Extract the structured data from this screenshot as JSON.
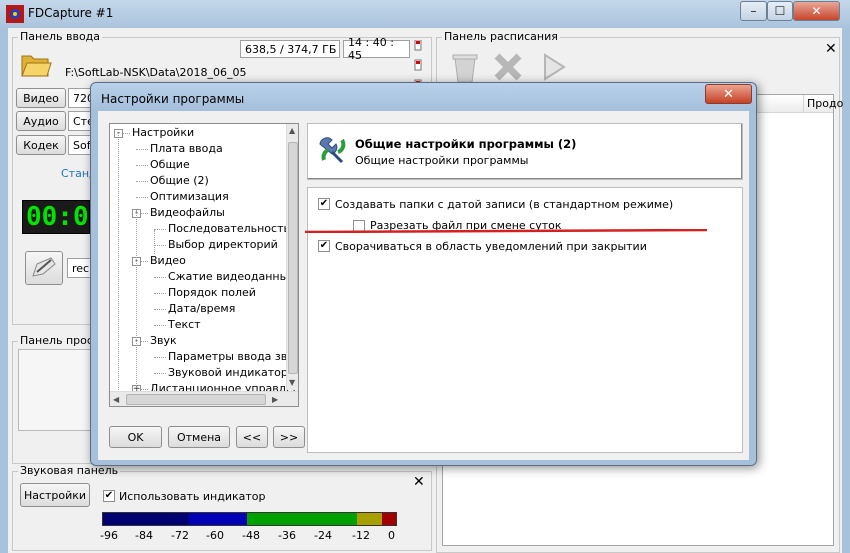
{
  "app": {
    "title": "FDCapture #1",
    "window_controls": {
      "minimize": "–",
      "maximize": "☐",
      "close": "✕"
    }
  },
  "input_panel": {
    "label": "Панель ввода",
    "disk_space": "638,5 / 374,7 ГБ",
    "time": "14 : 40 : 45",
    "path": "F:\\SoftLab-NSK\\Data\\2018_06_05",
    "video_label": "Видео",
    "video_value": "720",
    "audio_label": "Аудио",
    "audio_value": "Сте",
    "codec_label": "Кодек",
    "codec_value": "Soft",
    "standard_link": "Станд",
    "timer_display": "00:0",
    "filename_value": "rec#"
  },
  "preview_panel": {
    "label": "Панель просмо"
  },
  "sound_panel": {
    "label": "Звуковая панель",
    "settings_button": "Настройки",
    "use_indicator_label": "Использовать индикатор",
    "use_indicator_checked": true,
    "meter_ticks": [
      "-96",
      "-84",
      "-72",
      "-60",
      "-48",
      "-36",
      "-24",
      "-12",
      "0"
    ],
    "meter_colors": [
      "#000080",
      "#0000b0",
      "#00a000",
      "#a0a000",
      "#a00000"
    ]
  },
  "schedule_panel": {
    "label": "Панель расписания",
    "col_name": "Продо"
  },
  "dialog": {
    "title": "Настройки программы",
    "tree": [
      {
        "label": "Настройки",
        "level": 0,
        "expander": "-"
      },
      {
        "label": "Плата ввода",
        "level": 1
      },
      {
        "label": "Общие",
        "level": 1
      },
      {
        "label": "Общие (2)",
        "level": 1,
        "selected": true
      },
      {
        "label": "Оптимизация",
        "level": 1
      },
      {
        "label": "Видеофайлы",
        "level": 1,
        "expander": "-"
      },
      {
        "label": "Последовательность ф",
        "level": 2
      },
      {
        "label": "Выбор директорий",
        "level": 2
      },
      {
        "label": "Видео",
        "level": 1,
        "expander": "-"
      },
      {
        "label": "Сжатие видеоданных",
        "level": 2
      },
      {
        "label": "Порядок полей",
        "level": 2
      },
      {
        "label": "Дата/время",
        "level": 2
      },
      {
        "label": "Текст",
        "level": 2
      },
      {
        "label": "Звук",
        "level": 1,
        "expander": "-"
      },
      {
        "label": "Параметры ввода звук",
        "level": 2
      },
      {
        "label": "Звуковой индикатор",
        "level": 2
      },
      {
        "label": "Дистанционное управлен",
        "level": 1,
        "expander": "+"
      }
    ],
    "header_title": "Общие настройки программы (2)",
    "header_subtitle": "Общие настройки программы",
    "options": [
      {
        "label": "Создавать папки с датой записи (в стандартном режиме)",
        "checked": true
      },
      {
        "label": "Разрезать файл при смене суток",
        "checked": false
      },
      {
        "label": "Сворачиваться в область уведомлений при закрытии",
        "checked": true
      }
    ],
    "ok_label": "OK",
    "cancel_label": "Отмена",
    "prev_label": "<<",
    "next_label": ">>",
    "annotation_color": "#d42020"
  }
}
